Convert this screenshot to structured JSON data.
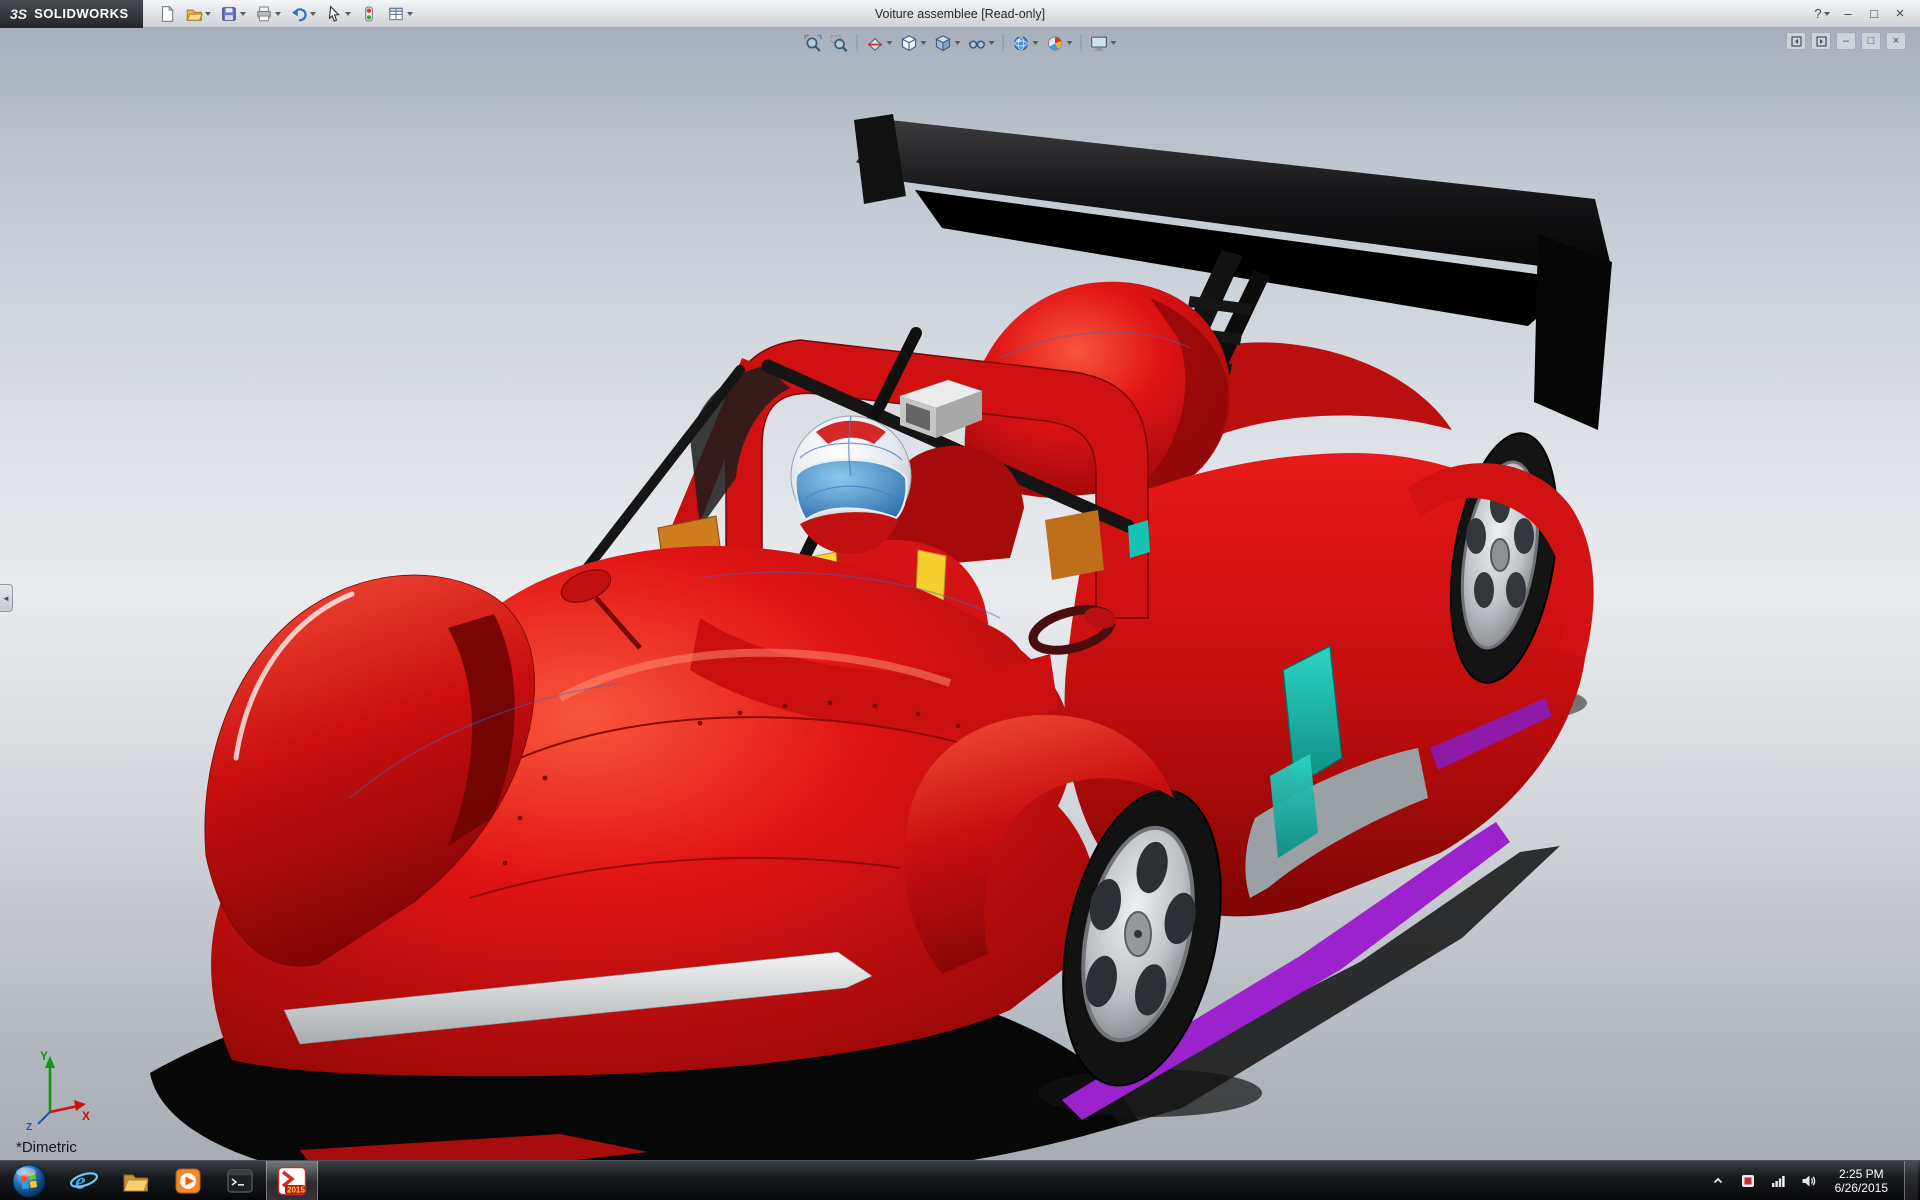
{
  "window": {
    "logo": "3S",
    "brand": "SOLIDWORKS",
    "title": "Voiture assemblee [Read-only]",
    "help": "?"
  },
  "titlebar_controls": {
    "minimize": "–",
    "restore": "□",
    "close": "×"
  },
  "main_toolbar": {
    "buttons": [
      {
        "icon": "new-document-icon"
      },
      {
        "icon": "open-folder-icon",
        "dropdown": true
      },
      {
        "icon": "save-icon",
        "dropdown": true
      },
      {
        "icon": "print-icon",
        "dropdown": true
      },
      {
        "icon": "undo-icon",
        "dropdown": true
      },
      {
        "icon": "select-cursor-icon",
        "dropdown": true
      },
      {
        "icon": "rebuild-icon"
      },
      {
        "icon": "options-icon",
        "dropdown": true
      }
    ]
  },
  "heads_up_toolbar": {
    "buttons": [
      {
        "icon": "zoom-to-fit-icon"
      },
      {
        "icon": "zoom-to-area-icon"
      },
      {
        "icon": "section-view-icon",
        "dropdown": true
      },
      {
        "icon": "view-orientation-icon",
        "dropdown": true
      },
      {
        "icon": "display-style-icon",
        "dropdown": true
      },
      {
        "icon": "hide-show-items-icon",
        "dropdown": true
      },
      {
        "icon": "apply-scene-icon",
        "dropdown": true
      },
      {
        "icon": "edit-appearance-icon",
        "dropdown": true
      },
      {
        "icon": "view-settings-icon",
        "dropdown": true
      }
    ]
  },
  "document_controls": {
    "minimize": "–",
    "restore": "□",
    "close": "×"
  },
  "viewport": {
    "view_orientation_label": "*Dimetric",
    "triad": {
      "x": "X",
      "y": "Y",
      "z": "Z"
    },
    "model": {
      "description": "Red LMP-style race car assembly with driver",
      "body_color": "#d31212",
      "wing_color": "#0b0b0b",
      "glass_color": "#14b2a4",
      "trim_color": "#9a22cc",
      "visor_color": "#2e7fc2"
    }
  },
  "taskbar": {
    "apps": [
      {
        "icon": "start-orb-icon"
      },
      {
        "icon": "internet-explorer-icon"
      },
      {
        "icon": "file-explorer-icon"
      },
      {
        "icon": "media-player-icon"
      },
      {
        "icon": "command-prompt-icon"
      },
      {
        "icon": "solidworks-2015-icon",
        "badge": "2015",
        "active": true
      }
    ],
    "tray": {
      "time": "2:25 PM",
      "date": "6/26/2015"
    }
  }
}
